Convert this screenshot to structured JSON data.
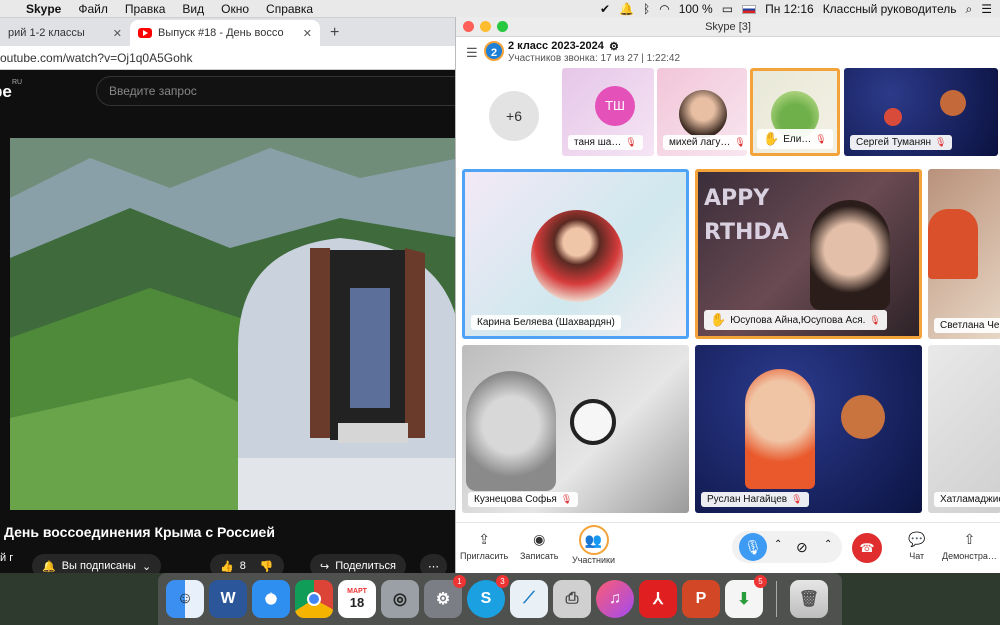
{
  "menubar": {
    "apple": "",
    "items": [
      "Skype",
      "Файл",
      "Правка",
      "Вид",
      "Окно",
      "Справка"
    ],
    "battery": "100 %",
    "clock": "Пн 12:16",
    "user": "Классный руководитель"
  },
  "browser": {
    "tab1": "рий 1-2 классы",
    "tab2": "Выпуск #18 - День воссо",
    "new_tab": "+",
    "url": "outube.com/watch?v=Oj1q0A5Gohk",
    "yt_logo": "be",
    "yt_ru": "RU",
    "search_placeholder": "Введите запрос",
    "video_title": "День воссоединения Крыма с Россией",
    "channel_fragment": "й г",
    "subscribed": "Вы подписаны",
    "likes": "8",
    "share": "Поделиться"
  },
  "skype": {
    "window_title": "Skype [3]",
    "group_avatar": "2",
    "group_name": "2 класс 2023-2024",
    "call_info": "Участников звонка: 17 из 27 | 1:22:42",
    "more_participants": "+6",
    "participants": [
      {
        "name": "таня ша…",
        "initials": "ТШ"
      },
      {
        "name": "михей лагу…"
      },
      {
        "name": "Ели…"
      },
      {
        "name": "Сергей Туманян"
      },
      {
        "name": "Карина Беляева (Шахвардян)"
      },
      {
        "name": "Юсупова Айна,Юсупова Ася."
      },
      {
        "name": "Светлана Чер"
      },
      {
        "name": "Кузнецова Софья"
      },
      {
        "name": "Руслан Нагайцев"
      },
      {
        "name": "Хатламаджие"
      }
    ],
    "balloon_text": "APPY RTHDA",
    "toolbar": {
      "invite": "Пригласить",
      "record": "Записать",
      "participants": "Участники",
      "chat": "Чат",
      "present": "Демонстра…"
    }
  },
  "dock": {
    "calendar_month": "МАРТ",
    "calendar_day": "18",
    "badges": {
      "prefs": "1",
      "skype": "3",
      "store": "5"
    }
  },
  "colors": {
    "skype_blue": "#3d9bf3",
    "raised_hand": "#f3a33a",
    "end_call": "#e02e2e"
  }
}
